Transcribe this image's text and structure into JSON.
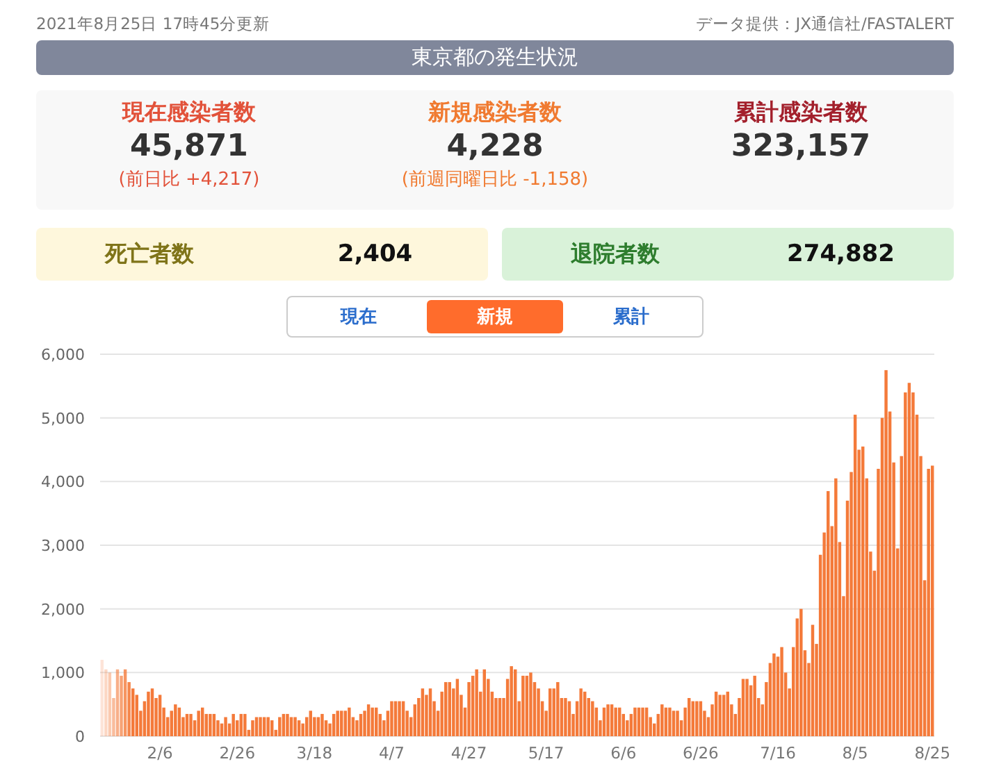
{
  "header": {
    "updated": "2021年8月25日 17時45分更新",
    "source": "データ提供：JX通信社/FASTALERT"
  },
  "title": "東京都の発生状況",
  "stats": [
    {
      "kind": "current",
      "label": "現在感染者数",
      "value": "45,871",
      "note": "(前日比 +4,217)"
    },
    {
      "kind": "new",
      "label": "新規感染者数",
      "value": "4,228",
      "note": "(前週同曜日比 -1,158)"
    },
    {
      "kind": "total",
      "label": "累計感染者数",
      "value": "323,157"
    }
  ],
  "cards": [
    {
      "kind": "deaths",
      "label": "死亡者数",
      "value": "2,404"
    },
    {
      "kind": "recovered",
      "label": "退院者数",
      "value": "274,882"
    }
  ],
  "tabs": [
    {
      "label": "現在",
      "selected": false
    },
    {
      "label": "新規",
      "selected": true
    },
    {
      "label": "累計",
      "selected": false
    }
  ],
  "chart_data": {
    "type": "bar",
    "grid": true,
    "ylim": [
      0,
      6000
    ],
    "yticks": [
      {
        "value": 0,
        "label": "0"
      },
      {
        "value": 1000,
        "label": "1,000"
      },
      {
        "value": 2000,
        "label": "2,000"
      },
      {
        "value": 3000,
        "label": "3,000"
      },
      {
        "value": 4000,
        "label": "4,000"
      },
      {
        "value": 5000,
        "label": "5,000"
      },
      {
        "value": 6000,
        "label": "6,000"
      }
    ],
    "categories": [
      null,
      null,
      null,
      null,
      null,
      null,
      null,
      null,
      null,
      null,
      null,
      null,
      null,
      null,
      null,
      "2/6",
      null,
      null,
      null,
      null,
      null,
      null,
      null,
      null,
      null,
      null,
      null,
      null,
      null,
      null,
      null,
      null,
      null,
      null,
      null,
      "2/26",
      null,
      null,
      null,
      null,
      null,
      null,
      null,
      null,
      null,
      null,
      null,
      null,
      null,
      null,
      null,
      null,
      null,
      null,
      null,
      "3/18",
      null,
      null,
      null,
      null,
      null,
      null,
      null,
      null,
      null,
      null,
      null,
      null,
      null,
      null,
      null,
      null,
      null,
      null,
      null,
      "4/7",
      null,
      null,
      null,
      null,
      null,
      null,
      null,
      null,
      null,
      null,
      null,
      null,
      null,
      null,
      null,
      null,
      null,
      null,
      null,
      "4/27",
      null,
      null,
      null,
      null,
      null,
      null,
      null,
      null,
      null,
      null,
      null,
      null,
      null,
      null,
      null,
      null,
      null,
      null,
      null,
      "5/17",
      null,
      null,
      null,
      null,
      null,
      null,
      null,
      null,
      null,
      null,
      null,
      null,
      null,
      null,
      null,
      null,
      null,
      null,
      null,
      "6/6",
      null,
      null,
      null,
      null,
      null,
      null,
      null,
      null,
      null,
      null,
      null,
      null,
      null,
      null,
      null,
      null,
      null,
      null,
      null,
      "6/26",
      null,
      null,
      null,
      null,
      null,
      null,
      null,
      null,
      null,
      null,
      null,
      null,
      null,
      null,
      null,
      null,
      null,
      null,
      null,
      "7/16",
      null,
      null,
      null,
      null,
      null,
      null,
      null,
      null,
      null,
      null,
      null,
      null,
      null,
      null,
      null,
      null,
      null,
      null,
      null,
      "8/5",
      null,
      null,
      null,
      null,
      null,
      null,
      null,
      null,
      null,
      null,
      null,
      null,
      null,
      null,
      null,
      null,
      null,
      null,
      null,
      "8/25"
    ],
    "series": [
      {
        "color": "#f47a3a",
        "values": [
          1200,
          1050,
          1000,
          600,
          1050,
          950,
          1050,
          850,
          750,
          650,
          400,
          550,
          700,
          750,
          600,
          650,
          450,
          300,
          400,
          500,
          450,
          300,
          350,
          350,
          250,
          400,
          450,
          350,
          350,
          350,
          250,
          200,
          300,
          200,
          350,
          250,
          350,
          350,
          100,
          250,
          300,
          300,
          300,
          300,
          250,
          100,
          300,
          350,
          350,
          300,
          300,
          250,
          200,
          300,
          400,
          300,
          300,
          350,
          250,
          200,
          350,
          400,
          400,
          400,
          450,
          300,
          250,
          350,
          400,
          500,
          450,
          450,
          350,
          250,
          400,
          550,
          550,
          550,
          550,
          400,
          300,
          500,
          600,
          750,
          650,
          750,
          550,
          400,
          700,
          850,
          850,
          750,
          900,
          650,
          450,
          850,
          950,
          1050,
          700,
          1050,
          900,
          700,
          600,
          600,
          600,
          900,
          1100,
          1050,
          550,
          950,
          950,
          1000,
          850,
          750,
          550,
          400,
          750,
          750,
          850,
          600,
          600,
          550,
          350,
          550,
          750,
          700,
          600,
          550,
          450,
          250,
          450,
          500,
          500,
          450,
          450,
          350,
          250,
          350,
          450,
          450,
          450,
          450,
          300,
          200,
          350,
          500,
          450,
          450,
          400,
          400,
          250,
          450,
          600,
          550,
          550,
          550,
          400,
          300,
          500,
          700,
          650,
          650,
          700,
          500,
          350,
          600,
          900,
          900,
          800,
          950,
          600,
          500,
          850,
          1150,
          1300,
          1250,
          1400,
          1000,
          750,
          1400,
          1850,
          2000,
          1350,
          1150,
          1750,
          1450,
          2850,
          3200,
          3850,
          3300,
          4050,
          3050,
          2200,
          3700,
          4150,
          5050,
          4500,
          4550,
          4050,
          2900,
          2600,
          4200,
          5000,
          5750,
          5100,
          4300,
          2950,
          4400,
          5400,
          5550,
          5400,
          5050,
          4400,
          2450,
          4200,
          4250
        ]
      }
    ]
  }
}
